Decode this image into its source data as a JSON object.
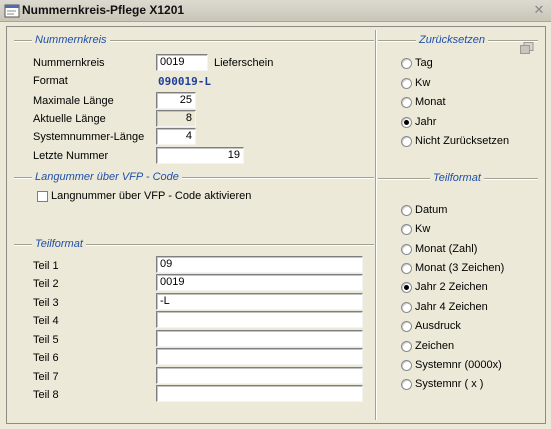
{
  "window": {
    "title": "Nummernkreis-Pflege X1201"
  },
  "nummernkreis": {
    "section_title": "Nummernkreis",
    "nummernkreis_label": "Nummernkreis",
    "nummernkreis_value": "0019",
    "nummernkreis_desc": "Lieferschein",
    "format_label": "Format",
    "format_value": "090019-L",
    "max_laenge_label": "Maximale Länge",
    "max_laenge_value": "25",
    "akt_laenge_label": "Aktuelle Länge",
    "akt_laenge_value": "8",
    "sysnr_laenge_label": "Systemnummer-Länge",
    "sysnr_laenge_value": "4",
    "letzte_nummer_label": "Letzte Nummer",
    "letzte_nummer_value": "19"
  },
  "langnummer": {
    "section_title": "Langummer über VFP - Code",
    "checkbox_label": "Langnummer über VFP - Code aktivieren",
    "checked": false
  },
  "teilformat_left": {
    "section_title": "Teilformat",
    "teile": [
      {
        "label": "Teil 1",
        "value": "09"
      },
      {
        "label": "Teil 2",
        "value": "0019"
      },
      {
        "label": "Teil 3",
        "value": "-L"
      },
      {
        "label": "Teil 4",
        "value": ""
      },
      {
        "label": "Teil 5",
        "value": ""
      },
      {
        "label": "Teil 6",
        "value": ""
      },
      {
        "label": "Teil 7",
        "value": ""
      },
      {
        "label": "Teil 8",
        "value": ""
      }
    ]
  },
  "zuruecksetzen": {
    "section_title": "Zurücksetzen",
    "options": [
      "Tag",
      "Kw",
      "Monat",
      "Jahr",
      "Nicht Zurücksetzen"
    ],
    "selected": "Jahr"
  },
  "teilformat_right": {
    "section_title": "Teilformat",
    "options": [
      "Datum",
      "Kw",
      "Monat (Zahl)",
      "Monat (3 Zeichen)",
      "Jahr 2 Zeichen",
      "Jahr 4 Zeichen",
      "Ausdruck",
      "Zeichen",
      "Systemnr (0000x)",
      "Systemnr ( x )"
    ],
    "selected": "Jahr 2 Zeichen"
  },
  "colors": {
    "section_title": "#1f4fa8",
    "format_code": "#1f3f9a",
    "background": "#ece9d8"
  },
  "icons": {
    "app": "app-window-icon",
    "close": "close-icon",
    "corner": "copy-icon"
  }
}
